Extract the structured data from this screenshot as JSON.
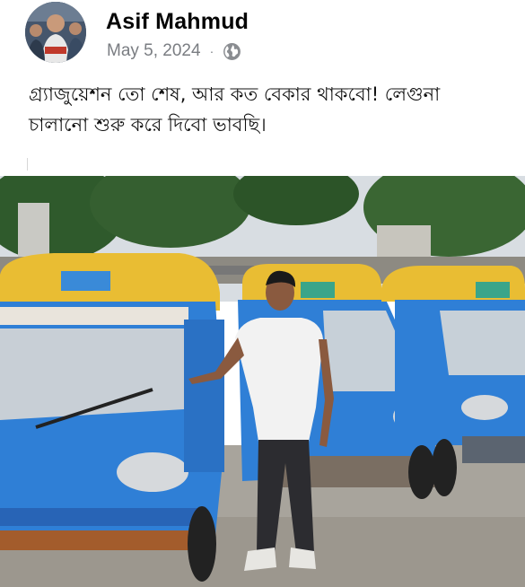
{
  "post": {
    "author_name": "Asif Mahmud",
    "date": "May 5, 2024",
    "separator": "·",
    "privacy_icon": "globe-icon",
    "caption_line1": "গ্র্যাজুয়েশন তো শেষ, আর কত বেকার থাকবো! লেগুনা",
    "caption_line2": "চালানো শুরু করে দিবো ভাবছি।"
  },
  "colors": {
    "author": "#050505",
    "meta": "#7a7d82",
    "vehicle_blue": "#2f7fd6",
    "roof_yellow": "#e9bd33",
    "sky": "#d8dde2",
    "ground": "#a8a49c"
  }
}
